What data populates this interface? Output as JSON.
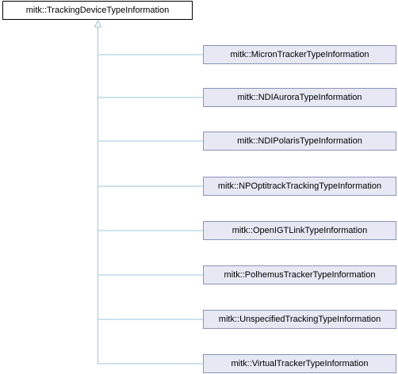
{
  "diagram": {
    "root": {
      "label": "mitk::TrackingDeviceTypeInformation"
    },
    "children": [
      {
        "label": "mitk::MicronTrackerTypeInformation"
      },
      {
        "label": "mitk::NDIAuroraTypeInformation"
      },
      {
        "label": "mitk::NDIPolarisTypeInformation"
      },
      {
        "label": "mitk::NPOptitrackTrackingTypeInformation"
      },
      {
        "label": "mitk::OpenIGTLinkTypeInformation"
      },
      {
        "label": "mitk::PolhemusTrackerTypeInformation"
      },
      {
        "label": "mitk::UnspecifiedTrackingTypeInformation"
      },
      {
        "label": "mitk::VirtualTrackerTypeInformation"
      }
    ],
    "colors": {
      "edge": "#9fc4dc",
      "child_fill": "#e6e9f4",
      "child_border": "#8a93b8",
      "root_border": "#000000"
    }
  }
}
